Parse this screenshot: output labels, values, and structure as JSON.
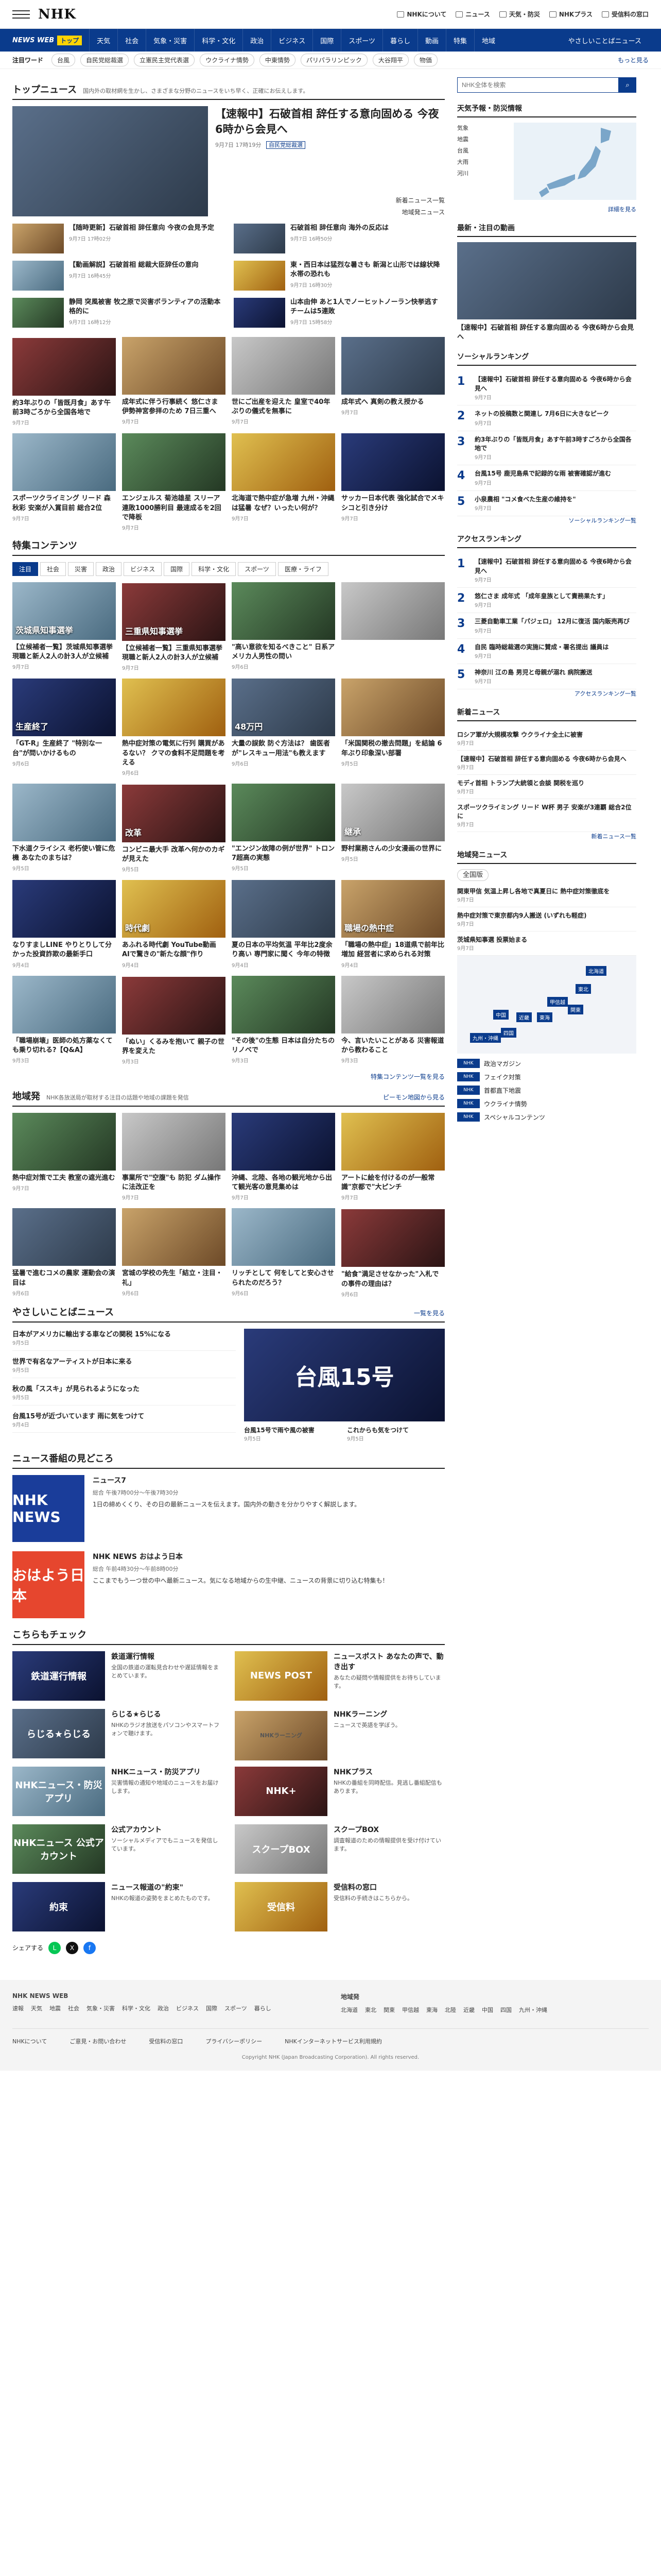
{
  "header": {
    "logo": "NHK",
    "links": [
      "NHKについて",
      "ニュース",
      "天気・防災",
      "NHKプラス",
      "受信料の窓口"
    ]
  },
  "nav": {
    "brand": "NEWS WEB",
    "brand_tag": "トップ",
    "items": [
      "天気",
      "社会",
      "気象・災害",
      "科学・文化",
      "政治",
      "ビジネス",
      "国際",
      "スポーツ",
      "暮らし",
      "動画",
      "特集",
      "地域"
    ],
    "more": "やさしいことばニュース"
  },
  "subnav": {
    "label": "注目ワード",
    "chips": [
      "台風",
      "自民党総裁選",
      "立憲民主党代表選",
      "ウクライナ情勢",
      "中東情勢",
      "パリパラリンピック",
      "大谷翔平",
      "物価"
    ],
    "more": "もっと見る"
  },
  "top_news": {
    "title": "トップニュース",
    "desc": "国内外の取材網を生かし、さまざまな分野のニュースをいち早く、正確にお伝えします。",
    "lead": {
      "title": "【速報中】石破首相 辞任する意向固める 今夜6時から会見へ",
      "date": "9月7日 17時19分",
      "tag": "自民党総裁選",
      "rel1": "新着ニュース一覧",
      "rel2": "地域発ニュース"
    },
    "pairs": [
      {
        "t": "【随時更新】石破首相 辞任意向 今夜の会見予定",
        "d": "9月7日 17時02分"
      },
      {
        "t": "石破首相 辞任意向 海外の反応は",
        "d": "9月7日 16時50分"
      },
      {
        "t": "【動画解説】石破首相 総裁大臣辞任の意向",
        "d": "9月7日 16時45分"
      },
      {
        "t": "東・西日本は猛烈な暑さも 新潟と山形では線状降水帯の恐れも",
        "d": "9月7日 16時30分"
      },
      {
        "t": "静岡 突風被害 牧之原で災害ボランティアの活動本格的に",
        "d": "9月7日 16時12分"
      },
      {
        "t": "山本由伸 あと1人でノーヒットノーラン快挙逃す チームは5連敗",
        "d": "9月7日 15時58分"
      }
    ],
    "cards": [
      {
        "t": "約3年ぶりの「皆既月食」あす午前3時ごろから全国各地で",
        "d": "9月7日"
      },
      {
        "t": "成年式に伴う行事続く 悠仁さま 伊勢神宮参拝のため 7日三重へ",
        "d": "9月7日"
      },
      {
        "t": "世にご出産を迎えた 皇室で40年ぶりの儀式を無事に",
        "d": "9月7日"
      },
      {
        "t": "成年式へ 真剣の教え授かる",
        "d": "9月7日"
      },
      {
        "t": "スポーツクライミング リード 森秋彩 安楽が入賞目前 総合2位",
        "d": "9月7日"
      },
      {
        "t": "エンジェルス 菊池雄星 スリーア連敗1000勝利目 最速成るを2回で降板",
        "d": "9月7日"
      },
      {
        "t": "北海道で熱中症が急増 九州・沖縄は猛暑 なぜ？いったい何が？",
        "d": "9月7日"
      },
      {
        "t": "サッカー日本代表 強化試合でメキシコと引き分け",
        "d": "9月7日"
      }
    ]
  },
  "features": {
    "title": "特集コンテンツ",
    "tabs": [
      "注目",
      "社会",
      "災害",
      "政治",
      "ビジネス",
      "国際",
      "科学・文化",
      "スポーツ",
      "医療・ライフ"
    ],
    "cards": [
      {
        "t": "【立候補者一覧】茨城県知事選挙 現職と新人2人の計3人が立候補",
        "d": "9月7日",
        "label": "茨城県知事選挙"
      },
      {
        "t": "【立候補者一覧】三重県知事選挙 現職と新人2人の計3人が立候補",
        "d": "9月7日",
        "label": "三重県知事選挙"
      },
      {
        "t": "\"高い意欲を知るべきこと\" 日系アメリカ人男性の問い",
        "d": "9月6日",
        "label": ""
      },
      {
        "t": "",
        "d": "",
        "label": ""
      },
      {
        "t": "「GT-R」生産終了 \"特別な一台\"が問いかけるもの",
        "d": "9月6日",
        "label": "生産終了"
      },
      {
        "t": "熱中症対策の電気に行列 購買があるない？ クマの食料不足問題を考える",
        "d": "9月6日",
        "label": ""
      },
      {
        "t": "大量の誤飲 防ぐ方法は？ 歯医者が\"レスキュー用法\"も教えます",
        "d": "9月6日",
        "label": "48万円"
      },
      {
        "t": "「米国関税の撤去問題」を結論 6年ぶり印象深い部署",
        "d": "9月5日",
        "label": ""
      },
      {
        "t": "下水道クライシス 老朽使い管に危機 あなたのまちは？",
        "d": "9月5日",
        "label": ""
      },
      {
        "t": "コンビニ最大手 改革へ何かのカギが見えた",
        "d": "9月5日",
        "label": "改革"
      },
      {
        "t": "\"エンジン故障の例が世界\" トロン7超高の実態",
        "d": "9月5日",
        "label": ""
      },
      {
        "t": "野村業務さんの少女漫画の世界に",
        "d": "9月5日",
        "label": "継承"
      },
      {
        "t": "なりすましLINE やりとりして分かった投資詐欺の最新手口",
        "d": "9月4日",
        "label": ""
      },
      {
        "t": "あふれる時代劇 YouTube動画 AIで驚きの\"新たな顔\"作り",
        "d": "9月4日",
        "label": "時代劇"
      },
      {
        "t": "夏の日本の平均気温 平年比2度余り高い 専門家に聞く 今年の特徴",
        "d": "9月4日",
        "label": ""
      },
      {
        "t": "「職場の熱中症」18道県で前年比増加 経営者に求められる対策",
        "d": "9月4日",
        "label": "職場の熱中症"
      },
      {
        "t": "「職場崩壊」医師の処方薬なくても乗り切れる?【Q&A】",
        "d": "9月3日",
        "label": ""
      },
      {
        "t": "「ぬい」くるみを抱いて 親子の世界を変えた",
        "d": "9月3日",
        "label": ""
      },
      {
        "t": "\"その後\"の生態 日本は自分たちのリノベで",
        "d": "9月3日",
        "label": ""
      },
      {
        "t": "今、言いたいことがある 災害報道から教わること",
        "d": "9月3日",
        "label": ""
      }
    ],
    "more": "特集コンテンツ一覧を見る"
  },
  "local": {
    "title": "地域発",
    "desc": "NHK各放送局が取材する注目の話題や地域の課題を発信",
    "link": "ピーモン地図から見る",
    "cards": [
      {
        "t": "熱中症対策で工夫 教室の遮光進む",
        "d": "9月7日"
      },
      {
        "t": "事業所で\"空腹\"も 防犯 ダム操作に法改正を",
        "d": "9月7日"
      },
      {
        "t": "沖縄、北陸、各地の観光地から出て観光客の意見集めは",
        "d": "9月7日"
      },
      {
        "t": "アートに絵を付けるのが一般常識\"京都で\"大ピンチ",
        "d": "9月7日"
      },
      {
        "t": "猛暑で進むコメの農家 運動会の演目は",
        "d": "9月6日"
      },
      {
        "t": "宮城の学校の先生「結立・注目・礼」",
        "d": "9月6日"
      },
      {
        "t": "リッチとして 何をしてと安心させられたのだろう？",
        "d": "9月6日"
      },
      {
        "t": "\"給食\"満足させなかった\"入札での事件の理由は？",
        "d": "9月6日"
      }
    ]
  },
  "easy": {
    "title": "やさしいことばニュース",
    "link": "一覧を見る",
    "items": [
      {
        "t": "日本がアメリカに輸出する車などの関税 15%になる",
        "d": "9月5日"
      },
      {
        "t": "世界で有名なアーティストが日本に来る",
        "d": "9月5日"
      },
      {
        "t": "秋の風「ススキ」が見られるようになった",
        "d": "9月5日"
      },
      {
        "t": "台風15号が近づいています 雨に気をつけて",
        "d": "9月4日"
      }
    ],
    "pair": [
      {
        "t": "台風15号で雨や風の被害",
        "d": "9月5日"
      },
      {
        "t": "これからも気をつけて",
        "d": "9月5日"
      }
    ],
    "banner": "台風15号"
  },
  "programs": {
    "title": "ニュース番組の見どころ",
    "list": [
      {
        "logo": "NHK NEWS",
        "name": "ニュース7",
        "sched": "総合 午後7時00分〜午後7時30分",
        "body": "1日の締めくくり、その日の最新ニュースを伝えます。国内外の動きを分かりやすく解説します。"
      },
      {
        "logo": "おはよう日本",
        "name": "NHK NEWS おはよう日本",
        "sched": "総合 午前4時30分〜午前8時00分",
        "body": "ここまでもう一つ世の中へ最新ニュース。気になる地域からの生中継、ニュースの背景に切り込む特集も！"
      }
    ]
  },
  "check": {
    "title": "こちらもチェック",
    "items": [
      {
        "label": "鉄道運行情報",
        "t": "鉄道運行情報",
        "b": "全国の鉄道の運転見合わせや遅延情報をまとめています。"
      },
      {
        "label": "NEWS POST",
        "t": "ニュースポスト あなたの声で、動き出す",
        "b": "あなたの疑問や情報提供をお待ちしています。"
      },
      {
        "label": "らじる★らじる",
        "t": "らじる★らじる",
        "b": "NHKのラジオ放送をパソコンやスマートフォンで聴けます。"
      },
      {
        "label": "NHKラーニング",
        "t": "NHKラーニング",
        "b": "ニュースで英語を学ぼう。"
      },
      {
        "label": "NHKニュース・防災アプリ",
        "t": "NHKニュース・防災アプリ",
        "b": "災害情報の通知や地域のニュースをお届けします。"
      },
      {
        "label": "NHK+",
        "t": "NHKプラス",
        "b": "NHKの番組を同時配信。見逃し番組配信もあります。"
      },
      {
        "label": "NHKニュース 公式アカウント",
        "t": "公式アカウント",
        "b": "ソーシャルメディアでもニュースを発信しています。"
      },
      {
        "label": "スクープBOX",
        "t": "スクープBOX",
        "b": "調査報道のための情報提供を受け付けています。"
      },
      {
        "label": "約束",
        "t": "ニュース報道の\"約束\"",
        "b": "NHKの報道の姿勢をまとめたものです。"
      },
      {
        "label": "受信料",
        "t": "受信料の窓口",
        "b": "受信料の手続きはこちらから。"
      }
    ]
  },
  "share": {
    "label": "シェアする"
  },
  "sidebar": {
    "search_placeholder": "NHK全体を検索",
    "weather": {
      "title": "天気予報・防災情報",
      "list": [
        "気象",
        "地震",
        "台風",
        "大雨",
        "河川"
      ],
      "link": "詳細を見る"
    },
    "video": {
      "title": "最新・注目の動画",
      "t": "【速報中】石破首相 辞任する意向固める 今夜6時から会見へ"
    },
    "social": {
      "title": "ソーシャルランキング",
      "ranks": [
        {
          "t": "【速報中】石破首相 辞任する意向固める 今夜6時から会見へ",
          "d": "9月7日"
        },
        {
          "t": "ネットの投稿数と関連し 7月6日に大きなピーク",
          "d": "9月7日"
        },
        {
          "t": "約3年ぶりの「皆既月食」あす午前3時すごろから全国各地で",
          "d": "9月7日"
        },
        {
          "t": "台風15号 鹿児島県で記録的な雨 被害確認が進む",
          "d": "9月7日"
        },
        {
          "t": "小泉農相 \"コメ食べた生産の維持を\"",
          "d": "9月7日"
        }
      ],
      "link": "ソーシャルランキング一覧"
    },
    "access": {
      "title": "アクセスランキング",
      "ranks": [
        {
          "t": "【速報中】石破首相 辞任する意向固める 今夜6時から会見へ",
          "d": "9月7日"
        },
        {
          "t": "悠仁さま 成年式 「成年皇族として責務果たす」",
          "d": "9月7日"
        },
        {
          "t": "三菱自動車工業「パジェロ」 12月に復活 国内販売再び",
          "d": "9月7日"
        },
        {
          "t": "自民 臨時総裁選の実施に賛成・署名提出 議員は",
          "d": "9月7日"
        },
        {
          "t": "神奈川 江の島 男児と母親が溺れ 病院搬送",
          "d": "9月7日"
        }
      ],
      "link": "アクセスランキング一覧"
    },
    "newest": {
      "title": "新着ニュース",
      "items": [
        {
          "t": "ロシア軍が大規模攻撃 ウクライナ全土に被害",
          "d": "9月7日"
        },
        {
          "t": "【速報中】石破首相 辞任する意向固める 今夜6時から会見へ",
          "d": "9月7日"
        },
        {
          "t": "モディ首相 トランプ大統領と会談 関税を巡り",
          "d": "9月7日"
        },
        {
          "t": "スポーツクライミング リード W杯 男子 安楽が3連覇 総合2位に",
          "d": "9月7日"
        }
      ],
      "link": "新着ニュース一覧"
    },
    "regional": {
      "title": "地域発ニュース",
      "select": "全国版",
      "items": [
        {
          "t": "関東甲信 気温上昇し各地で真夏日に 熱中症対策徹底を",
          "d": "9月7日"
        },
        {
          "t": "熱中症対策で東京都内9人搬送 (いずれも軽症)",
          "d": "9月7日"
        },
        {
          "t": "茨城県知事選 投票始まる",
          "d": "9月7日"
        }
      ],
      "regions": [
        "北海道",
        "東北",
        "関東",
        "甲信越",
        "東海",
        "近畿",
        "中国",
        "四国",
        "九州・沖縄"
      ]
    },
    "ext": [
      {
        "b": "NHK",
        "t": "政治マガジン"
      },
      {
        "b": "NHK",
        "t": "フェイク対策"
      },
      {
        "b": "NHK",
        "t": "首都直下地震"
      },
      {
        "b": "NHK",
        "t": "ウクライナ情勢"
      },
      {
        "b": "NHK",
        "t": "スペシャルコンテンツ"
      }
    ]
  },
  "footer": {
    "col1_title": "NHK NEWS WEB",
    "col1": [
      "速報",
      "天気",
      "地震",
      "社会",
      "気象・災害",
      "科学・文化",
      "政治",
      "ビジネス",
      "国際",
      "スポーツ",
      "暮らし"
    ],
    "col2_title": "地域発",
    "col2": [
      "北海道",
      "東北",
      "関東",
      "甲信越",
      "東海",
      "北陸",
      "近畿",
      "中国",
      "四国",
      "九州・沖縄"
    ],
    "bottom": [
      "NHKについて",
      "ご意見・お問い合わせ",
      "受信料の窓口",
      "プライバシーポリシー",
      "NHKインターネットサービス利用規約"
    ],
    "copy": "Copyright NHK (Japan Broadcasting Corporation). All rights reserved."
  }
}
